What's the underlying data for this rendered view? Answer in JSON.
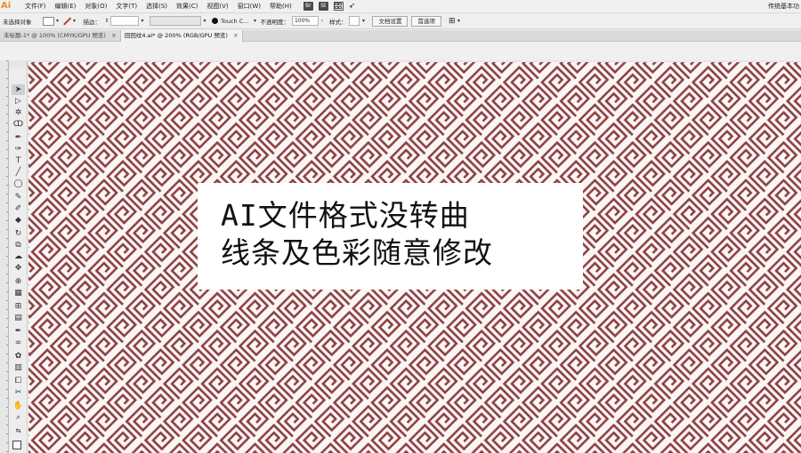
{
  "app": {
    "logo": "Ai",
    "workspace": "传统基本功"
  },
  "menu": [
    "文件(F)",
    "编辑(E)",
    "对象(O)",
    "文字(T)",
    "选择(S)",
    "效果(C)",
    "视图(V)",
    "窗口(W)",
    "帮助(H)"
  ],
  "menu_extras": {
    "bridge": "Br",
    "stock": "St"
  },
  "control_bar": {
    "selection_status": "未选择对象",
    "stroke_label": "描边：",
    "brush_name": "Touch C...",
    "opacity_label": "不透明度：",
    "opacity_value": "100%",
    "style_label": "样式：",
    "doc_setup_button": "文档设置",
    "preferences_button": "首选项"
  },
  "tabs": [
    {
      "label": "未标题-1* @ 100% (CMYK/GPU 预览)",
      "active": false
    },
    {
      "label": "回回纹4.ai* @ 200% (RGB/GPU 预览)",
      "active": true
    }
  ],
  "canvas": {
    "pattern_color": "#8b3d3d",
    "caption_lines": [
      "AI文件格式没转曲",
      "线条及色彩随意修改"
    ]
  }
}
